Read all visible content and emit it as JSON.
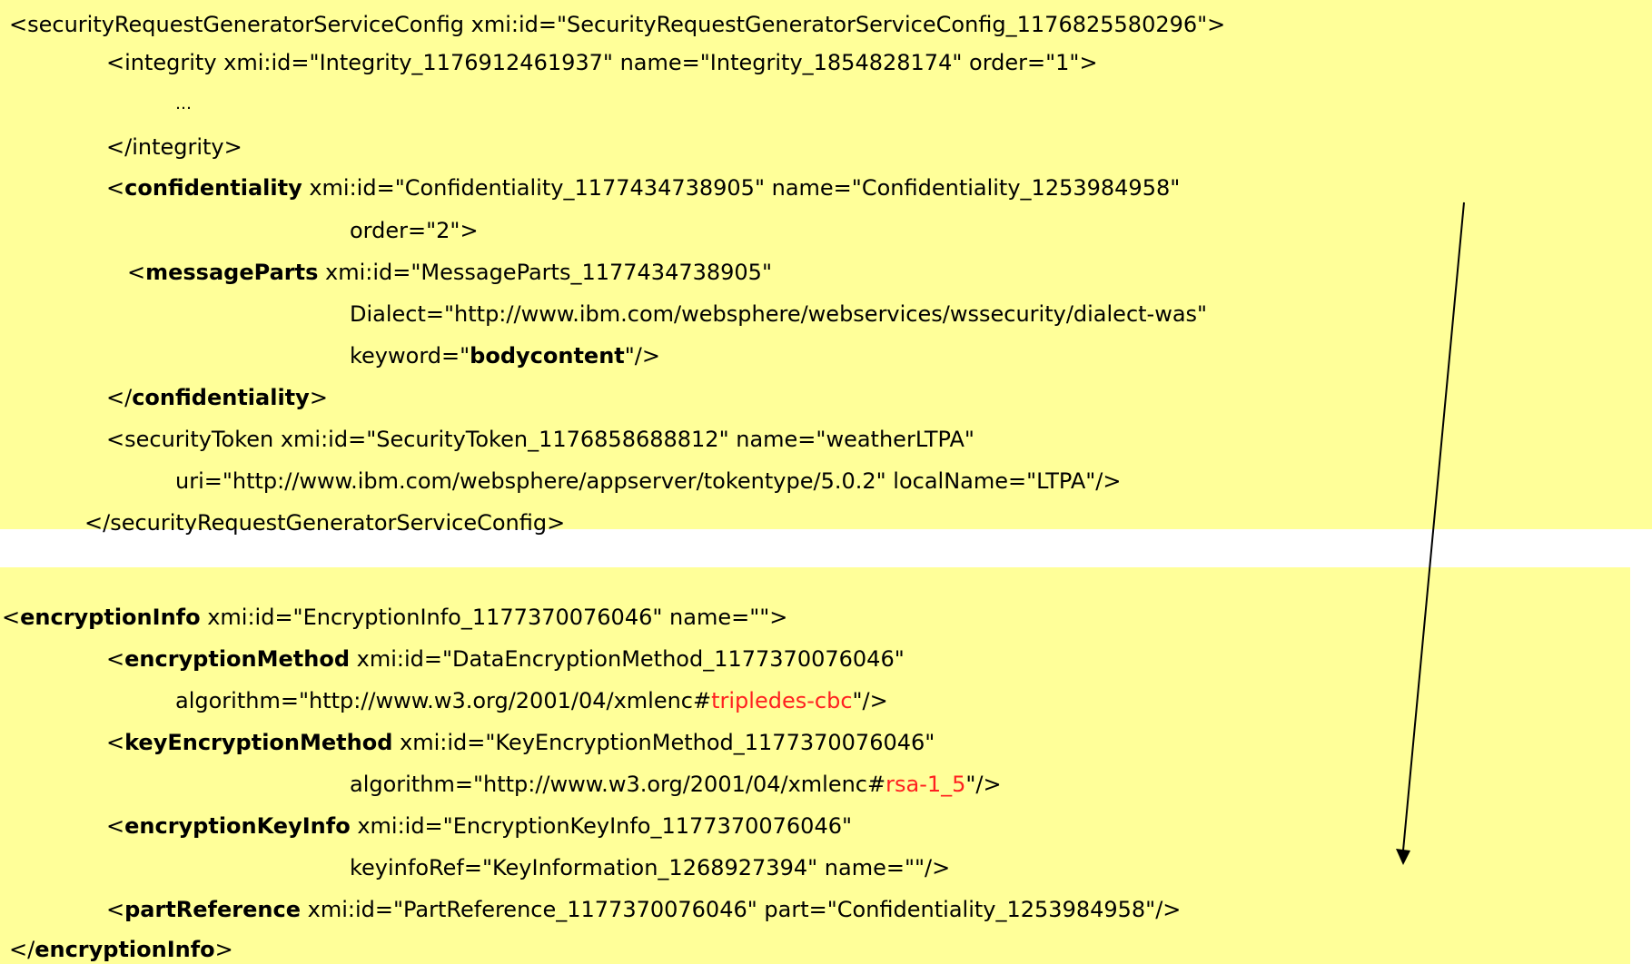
{
  "top_block": {
    "l01": {
      "a": "<securityRequestGeneratorServiceConfig xmi:id=\"SecurityRequestGeneratorServiceConfig_1176825580296\">"
    },
    "l02": {
      "a": "<integrity xmi:id=\"Integrity_1176912461937\" name=\"Integrity_1854828174\" order=\"1\">"
    },
    "l03": {
      "a": "…"
    },
    "l04": {
      "a": "</integrity>"
    },
    "l05": {
      "a": "<",
      "b": "confidentiality",
      "c": " xmi:id=\"Confidentiality_1177434738905\" name=\"Confidentiality_1253984958\""
    },
    "l06": {
      "a": "order=\"2\">"
    },
    "l07": {
      "a": "<",
      "b": "messageParts",
      "c": " xmi:id=\"MessageParts_1177434738905\""
    },
    "l08": {
      "a": "Dialect=\"http://www.ibm.com/websphere/webservices/wssecurity/dialect-was\""
    },
    "l09": {
      "a": "keyword=\"",
      "b": "bodycontent",
      "c": "\"/>"
    },
    "l10": {
      "a": "</",
      "b": "confidentiality",
      "c": ">"
    },
    "l11": {
      "a": "<securityToken xmi:id=\"SecurityToken_1176858688812\" name=\"weatherLTPA\""
    },
    "l12": {
      "a": "uri=\"http://www.ibm.com/websphere/appserver/tokentype/5.0.2\" localName=\"LTPA\"/>"
    },
    "l13": {
      "a": "</securityRequestGeneratorServiceConfig>"
    }
  },
  "bottom_block": {
    "l01": {
      "a": "<",
      "b": "encryptionInfo",
      "c": " xmi:id=\"EncryptionInfo_1177370076046\" name=\"\">"
    },
    "l02": {
      "a": "<",
      "b": "encryptionMethod",
      "c": " xmi:id=\"DataEncryptionMethod_1177370076046\""
    },
    "l03": {
      "a": "algorithm=\"http://www.w3.org/2001/04/xmlenc#",
      "r": "tripledes-cbc",
      "c": "\"/>"
    },
    "l04": {
      "a": "<",
      "b": "keyEncryptionMethod",
      "c": " xmi:id=\"KeyEncryptionMethod_1177370076046\""
    },
    "l05": {
      "a": "algorithm=\"http://www.w3.org/2001/04/xmlenc#",
      "r": "rsa-1_5",
      "c": "\"/>"
    },
    "l06": {
      "a": "<",
      "b": "encryptionKeyInfo",
      "c": " xmi:id=\"EncryptionKeyInfo_1177370076046\""
    },
    "l07": {
      "a": "keyinfoRef=\"KeyInformation_1268927394\" name=\"\"/>"
    },
    "l08": {
      "a": "<",
      "b": "partReference",
      "c": " xmi:id=\"PartReference_1177370076046\" part=\"Confidentiality_1253984958\"/>"
    },
    "l09": {
      "a": "</",
      "b": "encryptionInfo",
      "c": ">"
    }
  },
  "colors": {
    "panel_background": "#ffff99",
    "highlight_red": "#ff2020",
    "text": "#000000"
  },
  "connector": {
    "from": "name=\"Confidentiality_1253984958\"",
    "to": "part=\"Confidentiality_1253984958\""
  }
}
